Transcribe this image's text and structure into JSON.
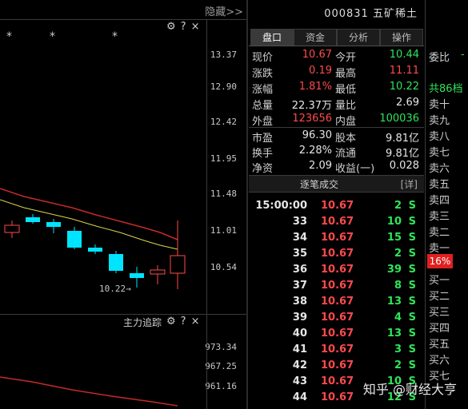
{
  "chart": {
    "hide_label": "隐藏>>",
    "price_ticks": [
      "13.37",
      "12.90",
      "12.42",
      "11.95",
      "11.48",
      "11.01",
      "10.54"
    ],
    "low_marker": "10.22→",
    "sub_title": "主力追踪",
    "sub_ticks": [
      "973.34",
      "967.25",
      "961.16"
    ],
    "tools": "⚙ ? ×",
    "star": "*"
  },
  "stock": {
    "code": "000831",
    "name": "五矿稀土"
  },
  "tabs": [
    {
      "label": "盘口",
      "active": true
    },
    {
      "label": "资金",
      "active": false
    },
    {
      "label": "分析",
      "active": false
    },
    {
      "label": "操作",
      "active": false
    }
  ],
  "quote": {
    "rows1": [
      {
        "l1": "现价",
        "v1": "10.67",
        "c1": "red",
        "l2": "今开",
        "v2": "10.44",
        "c2": "green"
      },
      {
        "l1": "涨跌",
        "v1": "0.19",
        "c1": "red",
        "l2": "最高",
        "v2": "11.11",
        "c2": "red"
      },
      {
        "l1": "涨幅",
        "v1": "1.81%",
        "c1": "red",
        "l2": "最低",
        "v2": "10.22",
        "c2": "green"
      },
      {
        "l1": "总量",
        "v1": "22.37万",
        "c1": "white",
        "l2": "量比",
        "v2": "2.69",
        "c2": "white"
      },
      {
        "l1": "外盘",
        "v1": "123656",
        "c1": "red",
        "l2": "内盘",
        "v2": "100036",
        "c2": "green"
      }
    ],
    "rows2": [
      {
        "l1": "市盈",
        "v1": "96.30",
        "l2": "股本",
        "v2": "9.81亿"
      },
      {
        "l1": "换手",
        "v1": "2.28%",
        "l2": "流通",
        "v2": "9.81亿"
      },
      {
        "l1": "净资",
        "v1": "2.09",
        "l2": "收益(一)",
        "v2": "0.028"
      }
    ]
  },
  "trades": {
    "title": "逐笔成交",
    "detail": "[详]",
    "rows": [
      {
        "t": "15:00:00",
        "p": "10.67",
        "v": "2",
        "s": "S"
      },
      {
        "t": "33",
        "p": "10.67",
        "v": "10",
        "s": "S"
      },
      {
        "t": "34",
        "p": "10.67",
        "v": "15",
        "s": "S"
      },
      {
        "t": "35",
        "p": "10.67",
        "v": "2",
        "s": "S"
      },
      {
        "t": "36",
        "p": "10.67",
        "v": "39",
        "s": "S"
      },
      {
        "t": "37",
        "p": "10.67",
        "v": "8",
        "s": "S"
      },
      {
        "t": "38",
        "p": "10.67",
        "v": "13",
        "s": "S"
      },
      {
        "t": "39",
        "p": "10.67",
        "v": "4",
        "s": "S"
      },
      {
        "t": "40",
        "p": "10.67",
        "v": "13",
        "s": "S"
      },
      {
        "t": "41",
        "p": "10.67",
        "v": "3",
        "s": "S"
      },
      {
        "t": "42",
        "p": "10.67",
        "v": "2",
        "s": "S"
      },
      {
        "t": "43",
        "p": "10.67",
        "v": "10",
        "s": "S"
      },
      {
        "t": "44",
        "p": "10.67",
        "v": "12",
        "s": "S"
      }
    ]
  },
  "book": {
    "weibi": "委比",
    "weibi_val": "-",
    "total": "共86档",
    "sell": [
      "卖十",
      "卖九",
      "卖八",
      "卖七",
      "卖六",
      "卖五",
      "卖四",
      "卖三",
      "卖二",
      "卖一"
    ],
    "pct": "16%",
    "buy": [
      "买一",
      "买二",
      "买三",
      "买四",
      "买五",
      "买六",
      "买七"
    ]
  },
  "watermark": "知乎 @财经大亨",
  "colors": {
    "up": "#ff4a4a",
    "down": "#2fe45a",
    "candle_down": "#00e5ff",
    "ma_red": "#c42a2a",
    "ma_yellow": "#d8d84a"
  }
}
